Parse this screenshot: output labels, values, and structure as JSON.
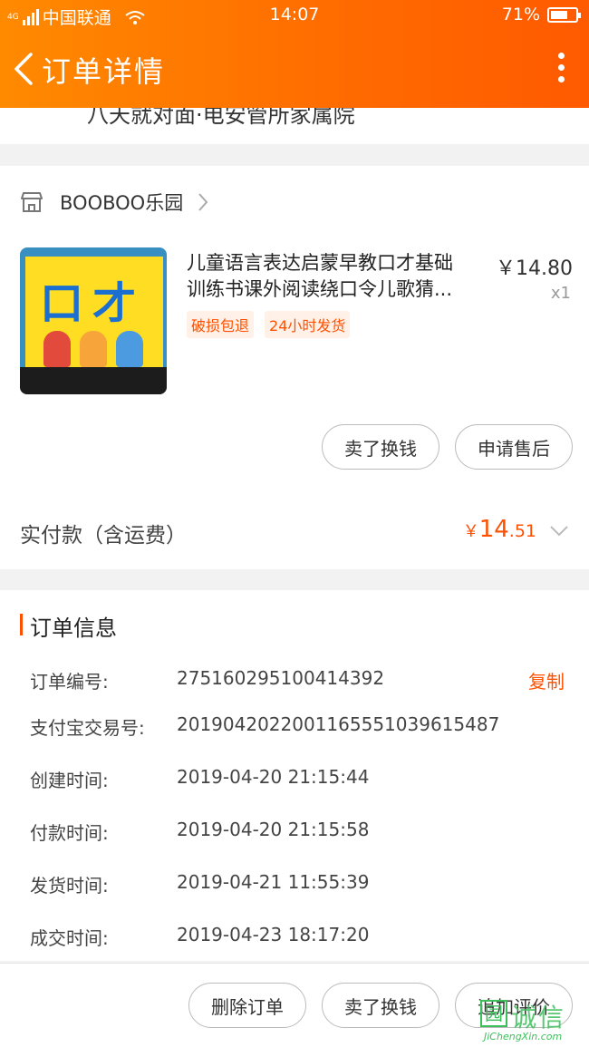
{
  "status_bar": {
    "network": "4G",
    "carrier": "中国联通",
    "time": "14:07",
    "battery_text": "71%",
    "battery_level": 0.71
  },
  "nav": {
    "title": "订单详情"
  },
  "top_card": {
    "cut_text": "八天就对面·电安管所家属院"
  },
  "shop": {
    "name": "BOOBOO乐园"
  },
  "product": {
    "title_line1": "儿童语言表达启蒙早教口才基础",
    "title_line2": "训练书课外阅读绕口令儿歌猜...",
    "price": "￥14.80",
    "qty": "x1",
    "tags": [
      "破损包退",
      "24小时发货"
    ],
    "cover_title": "口才"
  },
  "actions": {
    "sell": "卖了换钱",
    "aftersale": "申请售后"
  },
  "payment": {
    "label": "实付款（含运费）",
    "symbol": "￥",
    "integer": "14",
    "decimal": ".51"
  },
  "order_info": {
    "title": "订单信息",
    "copy_label": "复制",
    "rows": [
      {
        "label": "订单编号:",
        "value": "275160295100414392"
      },
      {
        "label": "支付宝交易号:",
        "value": "2019042022001165551039615487"
      },
      {
        "label": "创建时间:",
        "value": "2019-04-20 21:15:44"
      },
      {
        "label": "付款时间:",
        "value": "2019-04-20 21:15:58"
      },
      {
        "label": "发货时间:",
        "value": "2019-04-21 11:55:39"
      },
      {
        "label": "成交时间:",
        "value": "2019-04-23 18:17:20"
      }
    ]
  },
  "bottom_bar": {
    "delete": "删除订单",
    "sell": "卖了换钱",
    "review": "追加评价"
  },
  "watermark": {
    "glyph": "园",
    "text": "诚信",
    "sub": "JiChengXin.com"
  },
  "colors": {
    "header_start": "#ff8a00",
    "header_end": "#ff5a00",
    "accent": "#ff5000"
  }
}
